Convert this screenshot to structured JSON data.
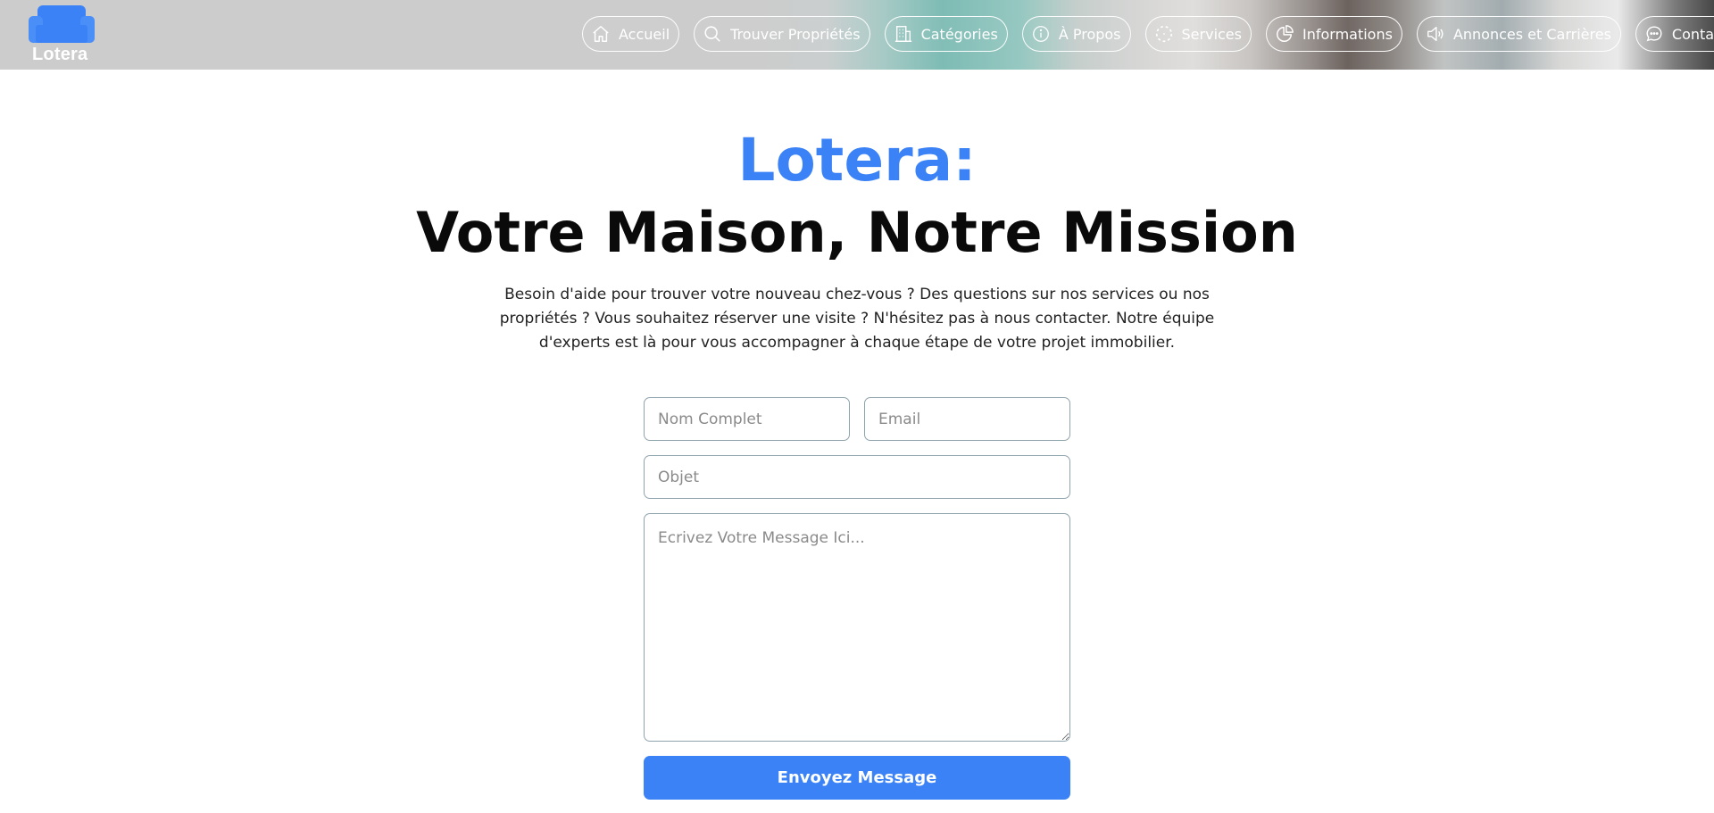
{
  "brand": {
    "name": "Lotera",
    "accent_color": "#3b82f6"
  },
  "nav": {
    "items": [
      {
        "label": "Accueil",
        "icon": "home-icon"
      },
      {
        "label": "Trouver Propriétés",
        "icon": "search-icon"
      },
      {
        "label": "Catégories",
        "icon": "building-icon"
      },
      {
        "label": "À Propos",
        "icon": "info-icon"
      },
      {
        "label": "Services",
        "icon": "dashed-circle-icon"
      },
      {
        "label": "Informations",
        "icon": "pie-chart-icon"
      },
      {
        "label": "Annonces et Carrières",
        "icon": "megaphone-icon"
      },
      {
        "label": "Contact",
        "icon": "chat-icon"
      }
    ]
  },
  "hero": {
    "brand_title": "Lotera:",
    "title": "Votre Maison, Notre Mission",
    "intro": "Besoin d'aide pour trouver votre nouveau chez-vous ? Des questions sur nos services ou nos propriétés ? Vous souhaitez réserver une visite ? N'hésitez pas à nous contacter. Notre équipe d'experts est là pour vous accompagner à chaque étape de votre projet immobilier."
  },
  "form": {
    "name_placeholder": "Nom Complet",
    "email_placeholder": "Email",
    "subject_placeholder": "Objet",
    "message_placeholder": "Ecrivez Votre Message Ici...",
    "name_value": "",
    "email_value": "",
    "subject_value": "",
    "message_value": "",
    "submit_label": "Envoyez Message"
  }
}
